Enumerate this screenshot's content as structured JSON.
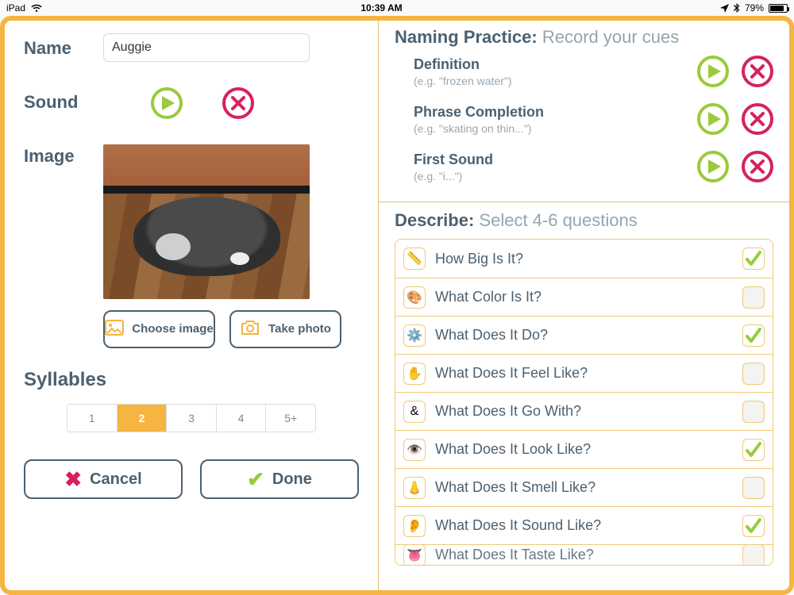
{
  "status": {
    "carrier": "iPad",
    "time": "10:39 AM",
    "battery_pct": "79%"
  },
  "left": {
    "name_label": "Name",
    "name_value": "Auggie",
    "sound_label": "Sound",
    "image_label": "Image",
    "choose_image": "Choose image",
    "take_photo": "Take photo",
    "syllables_label": "Syllables",
    "syllable_options": [
      "1",
      "2",
      "3",
      "4",
      "5+"
    ],
    "syllable_selected": "2",
    "cancel": "Cancel",
    "done": "Done"
  },
  "naming": {
    "title": "Naming Practice:",
    "subtitle": "Record your cues",
    "cues": [
      {
        "title": "Definition",
        "example": "(e.g. \"frozen water\")"
      },
      {
        "title": "Phrase Completion",
        "example": "(e.g. \"skating on thin...\")"
      },
      {
        "title": "First Sound",
        "example": "(e.g. \"i...\")"
      }
    ]
  },
  "describe": {
    "title": "Describe:",
    "subtitle": "Select 4-6 questions",
    "questions": [
      {
        "icon": "📏",
        "label": "How Big Is It?",
        "checked": true
      },
      {
        "icon": "🎨",
        "label": "What Color Is It?",
        "checked": false
      },
      {
        "icon": "⚙️",
        "label": "What Does It Do?",
        "checked": true
      },
      {
        "icon": "✋",
        "label": "What Does It Feel Like?",
        "checked": false
      },
      {
        "icon": "&",
        "label": "What Does It Go With?",
        "checked": false
      },
      {
        "icon": "👁️",
        "label": "What Does It Look Like?",
        "checked": true
      },
      {
        "icon": "👃",
        "label": "What Does It Smell Like?",
        "checked": false
      },
      {
        "icon": "👂",
        "label": "What Does It Sound Like?",
        "checked": true
      },
      {
        "icon": "👅",
        "label": "What Does It Taste Like?",
        "checked": false
      }
    ]
  }
}
